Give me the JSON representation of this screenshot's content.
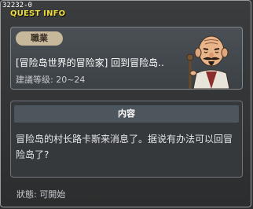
{
  "quest_id": "32232-0",
  "window": {
    "title": "QUEST INFO"
  },
  "header": {
    "badge": "職業",
    "quest_name": "[冒险岛世界的冒险家] 回到冒险岛..",
    "level": "建議等级: 20~24",
    "portrait_icon": "old-chief-portrait-icon"
  },
  "content": {
    "header": "内容",
    "text": "冒险岛的村长路卡斯来消息了。据说有办法可以回冒险岛了?"
  },
  "status": "狀態: 可開始",
  "colors": {
    "title": "#f0dc3c",
    "badge_bg": "#c7b79b",
    "panel_bg": "#3c4146"
  }
}
